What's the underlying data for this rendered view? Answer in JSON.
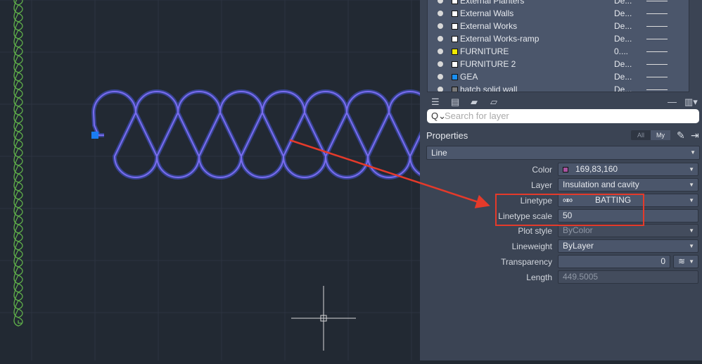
{
  "canvas": {
    "object_color": "#6f6cf2",
    "grip_color": "#1a7df2",
    "side_color": "#5fae4a",
    "annotation_color": "#e53a2a"
  },
  "layers": [
    {
      "name": "External Planters",
      "desc": "De...",
      "color": "#ffffff"
    },
    {
      "name": "External Walls",
      "desc": "De...",
      "color": "#ffffff"
    },
    {
      "name": "External Works",
      "desc": "De...",
      "color": "#ffffff"
    },
    {
      "name": "External Works-ramp",
      "desc": "De...",
      "color": "#ffffff"
    },
    {
      "name": "FURNITURE",
      "desc": "0....",
      "color": "#f2ea00"
    },
    {
      "name": "FURNITURE 2",
      "desc": "De...",
      "color": "#ffffff"
    },
    {
      "name": "GEA",
      "desc": "De...",
      "color": "#1a8ff2"
    },
    {
      "name": "hatch solid wall",
      "desc": "De...",
      "color": "#7a7a7a"
    }
  ],
  "toolbar": {
    "icons": [
      "layer-states-icon",
      "layer-properties-icon",
      "open-folder-icon",
      "new-group-folder-icon"
    ],
    "minus": "—",
    "columns": "▥▾"
  },
  "search": {
    "placeholder": "Search for layer",
    "icon": "Q⌄"
  },
  "properties": {
    "title": "Properties",
    "all": "All",
    "my": "My",
    "object_type": "Line",
    "rows": [
      {
        "label": "Color",
        "value": "169,83,160",
        "swatch": "#a953a0"
      },
      {
        "label": "Layer",
        "value": "Insulation and cavity"
      },
      {
        "label": "Linetype",
        "value": "BATTING"
      },
      {
        "label": "Linetype scale",
        "value": "50"
      },
      {
        "label": "Plot style",
        "value": "ByColor"
      },
      {
        "label": "Lineweight",
        "value": "ByLayer"
      },
      {
        "label": "Transparency",
        "value": "0"
      },
      {
        "label": "Length",
        "value": "449.5005"
      }
    ]
  }
}
